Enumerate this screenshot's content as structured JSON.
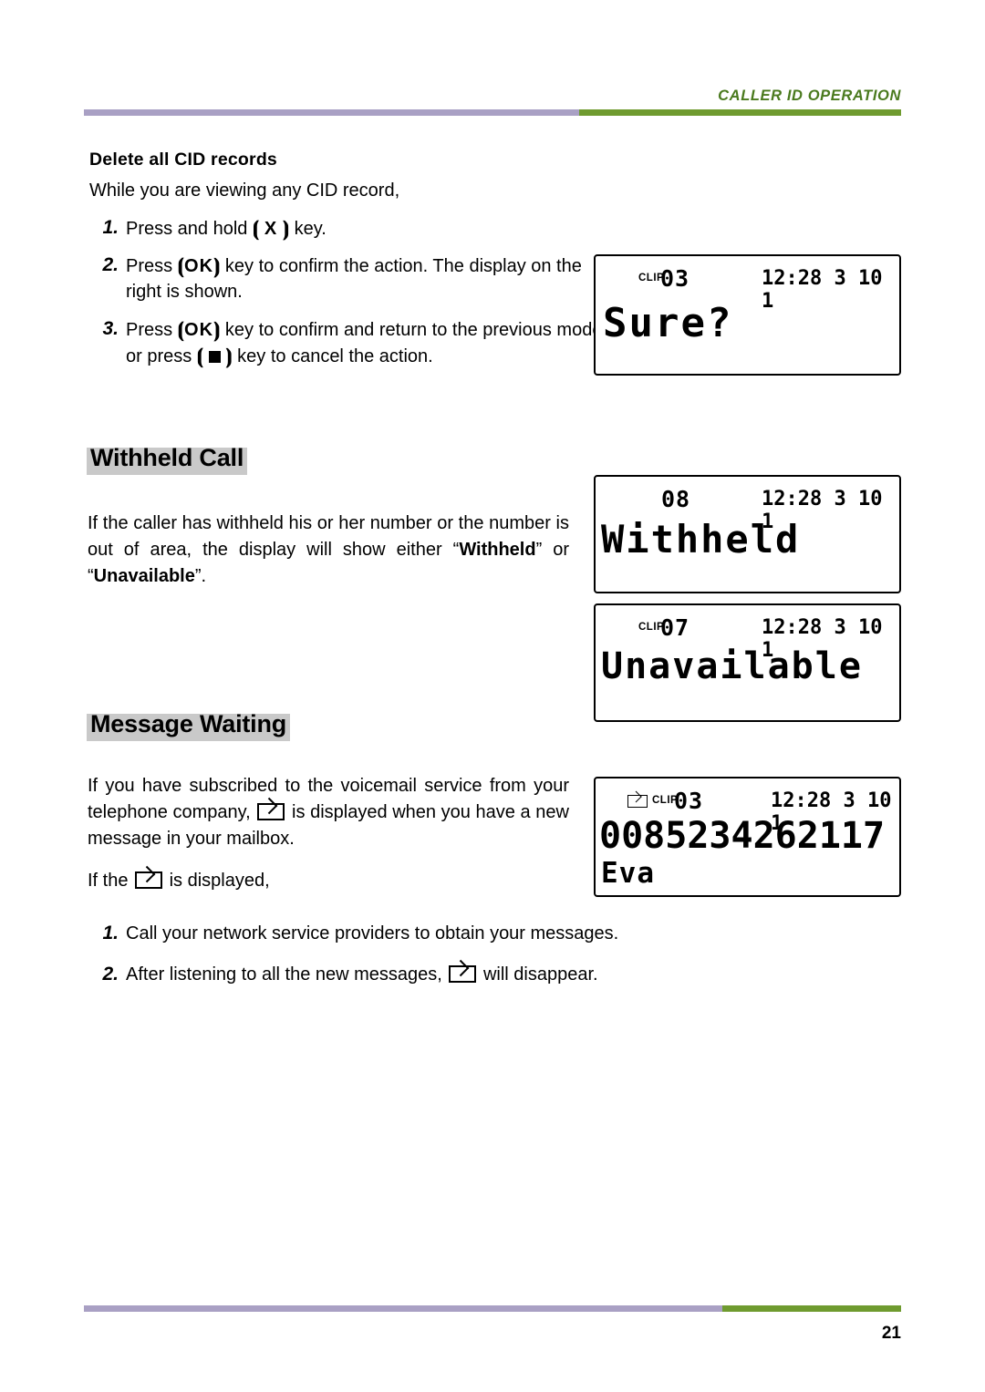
{
  "header": {
    "title": "CALLER ID OPERATION",
    "rule_left_color": "#a9a0c4",
    "rule_right_color": "#6f9b2f"
  },
  "footer": {
    "page_number": "21"
  },
  "delete_section": {
    "heading": "Delete all CID records",
    "intro": "While you are viewing any CID record,",
    "steps": [
      {
        "num": "1.",
        "text_before": "Press and hold ",
        "key": "X",
        "text_after": " key."
      },
      {
        "num": "2.",
        "text_before": "Press ",
        "key": "OK",
        "text_after": " key to confirm the action. The display on the right is shown."
      },
      {
        "num": "3.",
        "text_before": "Press ",
        "key": "OK",
        "text_after": " key to confirm and return to the previous mode; or press ",
        "key2": "square",
        "text_after2": " key to cancel the action."
      }
    ]
  },
  "withheld_section": {
    "title": "Withheld Call",
    "paragraph": "If the caller has withheld his or her number or the number is out of area, the display will show either “Withheld” or “Unavailable”.",
    "bold_1": "Withheld",
    "bold_2": "Unavailable"
  },
  "message_section": {
    "title": "Message Waiting",
    "paragraph_part1": "If you have subscribed to the voicemail service from your telephone company, ",
    "paragraph_part2": " is displayed when you have a new message in your mailbox.",
    "if_line_part1": "If the ",
    "if_line_part2": " is displayed,",
    "steps": [
      {
        "num": "1.",
        "text": "Call your network service providers to obtain your messages."
      },
      {
        "num": "2.",
        "text_before": "After listening to all the new messages, ",
        "text_after": " will disappear."
      }
    ]
  },
  "lcd_panels": {
    "sure": {
      "clip_label": "CLIP",
      "record_number": "03",
      "time": "12:28 3 10 1",
      "main_text": "Sure?"
    },
    "withheld": {
      "clip_label": "",
      "record_number": "08",
      "time": "12:28 3 10 1",
      "main_text": "Withheld"
    },
    "unavailable": {
      "clip_label": "CLIP",
      "record_number": "07",
      "time": "12:28 3 10 1",
      "main_text": "Unavailable"
    },
    "message": {
      "envelope_icon": "envelope-icon",
      "clip_label": "CLIP",
      "record_number": "03",
      "time": "12:28 3 10 1",
      "big_number": "0085234262117",
      "caller_name": "Eva"
    }
  }
}
